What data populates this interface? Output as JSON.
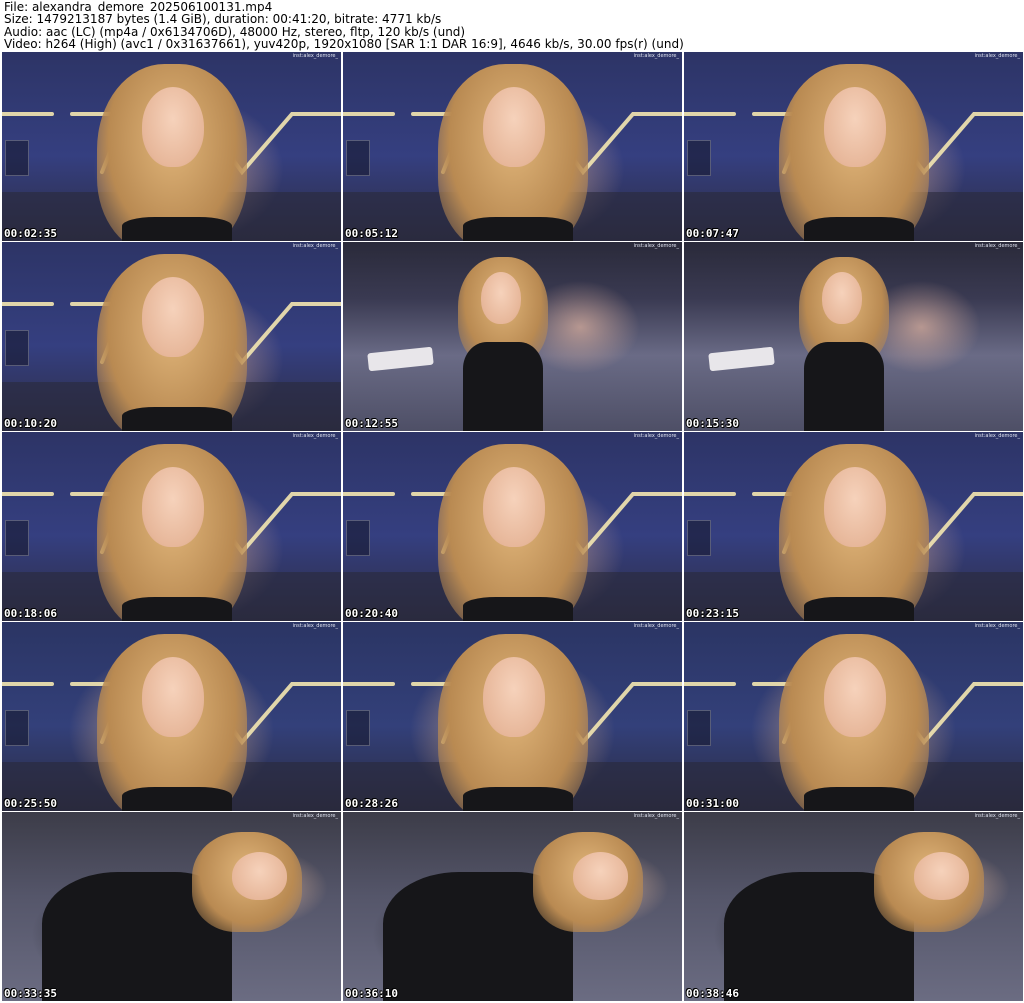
{
  "header": {
    "file_line": "File: alexandra_demore_202506100131.mp4",
    "size_line": "Size: 1479213187 bytes (1.4 GiB), duration: 00:41:20, bitrate: 4771 kb/s",
    "audio_line": "Audio: aac (LC) (mp4a / 0x6134706D), 48000 Hz, stereo, fltp, 120 kb/s (und)",
    "video_line": "Video: h264 (High) (avc1 / 0x31637661), yuv420p, 1920x1080 [SAR 1:1 DAR 16:9], 4646 kb/s, 30.00 fps(r) (und)"
  },
  "watermark": "inst:alex_demore_",
  "thumbnails": [
    {
      "timestamp": "00:02:35",
      "scene": "neon-wall"
    },
    {
      "timestamp": "00:05:12",
      "scene": "neon-wall"
    },
    {
      "timestamp": "00:07:47",
      "scene": "neon-wall"
    },
    {
      "timestamp": "00:10:20",
      "scene": "neon-wall"
    },
    {
      "timestamp": "00:12:55",
      "scene": "bed"
    },
    {
      "timestamp": "00:15:30",
      "scene": "bed"
    },
    {
      "timestamp": "00:18:06",
      "scene": "neon-wall"
    },
    {
      "timestamp": "00:20:40",
      "scene": "neon-wall"
    },
    {
      "timestamp": "00:23:15",
      "scene": "neon-wall"
    },
    {
      "timestamp": "00:25:50",
      "scene": "neon-wall-warm"
    },
    {
      "timestamp": "00:28:26",
      "scene": "neon-wall-warm"
    },
    {
      "timestamp": "00:31:00",
      "scene": "neon-wall-warm"
    },
    {
      "timestamp": "00:33:35",
      "scene": "lying"
    },
    {
      "timestamp": "00:36:10",
      "scene": "lying"
    },
    {
      "timestamp": "00:38:46",
      "scene": "lying"
    }
  ],
  "colors": {
    "wall": "#353f80",
    "neon": "#f4e7b0",
    "timestamp_text": "#ffffff"
  }
}
